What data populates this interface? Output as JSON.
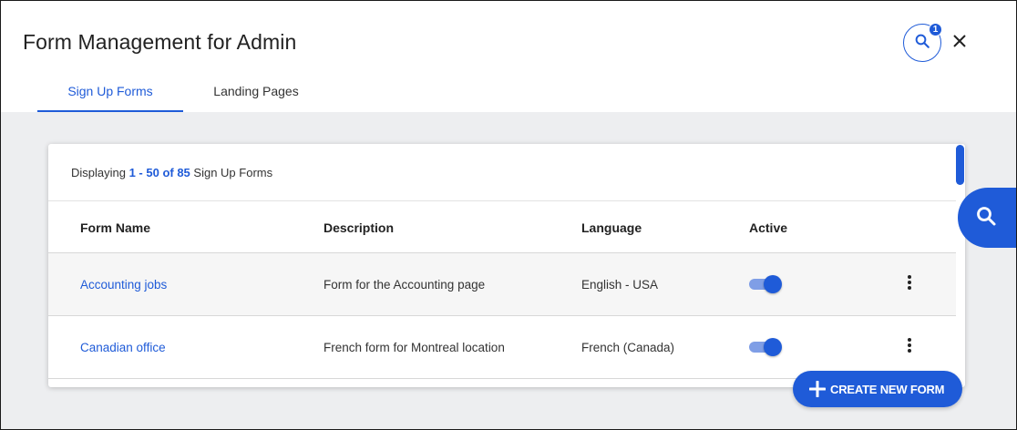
{
  "header": {
    "title": "Form Management for Admin",
    "help_badge_count": "1",
    "icons": {
      "help": "search-icon",
      "close": "close-icon"
    }
  },
  "tabs": [
    {
      "label": "Sign Up Forms",
      "active": true
    },
    {
      "label": "Landing Pages",
      "active": false
    }
  ],
  "table": {
    "display": {
      "prefix": "Displaying ",
      "count": "1 - 50 of 85",
      "suffix": " Sign Up Forms"
    },
    "columns": [
      "Form Name",
      "Description",
      "Language",
      "Active"
    ],
    "rows": [
      {
        "name": "Accounting jobs",
        "description": "Form for the Accounting page",
        "language": "English - USA",
        "active": true
      },
      {
        "name": "Canadian office",
        "description": "French form for Montreal location",
        "language": "French (Canada)",
        "active": true
      }
    ]
  },
  "actions": {
    "create_label": "CREATE NEW FORM",
    "side_search_icon": "search-icon"
  },
  "colors": {
    "accent": "#1f5bd8",
    "toggle_track": "#7f9ee6",
    "content_bg": "#edeef0"
  }
}
